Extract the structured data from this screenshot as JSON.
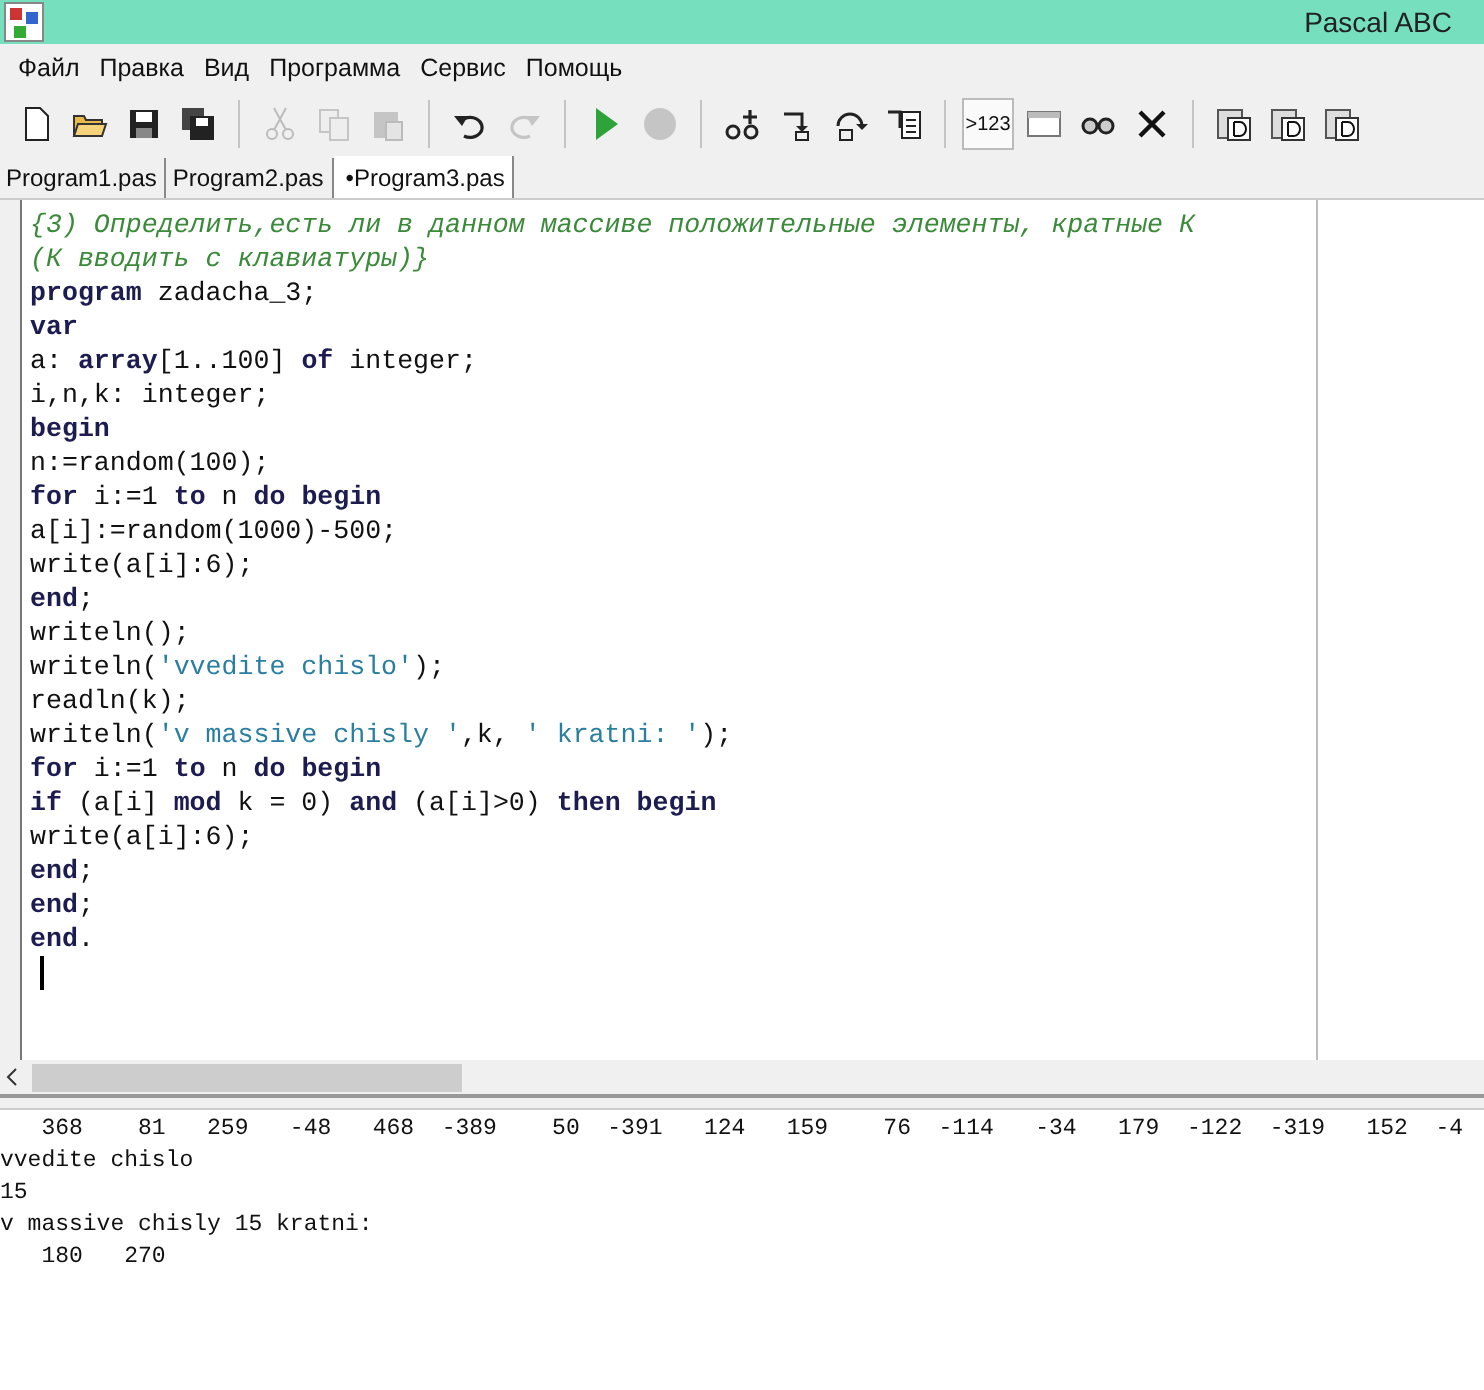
{
  "window": {
    "title": "Pascal ABC"
  },
  "menu": [
    "Файл",
    "Правка",
    "Вид",
    "Программа",
    "Сервис",
    "Помощь"
  ],
  "toolbar": {
    "output_toggle": {
      "label": ">123",
      "pressed": true
    }
  },
  "tabs": [
    {
      "label": "Program1.pas",
      "selected": false
    },
    {
      "label": "Program2.pas",
      "selected": false
    },
    {
      "label": "•Program3.pas",
      "selected": true
    }
  ],
  "editor": {
    "lines": [
      [
        {
          "kind": "comment",
          "text": "{3) Определить,есть ли в данном массиве положительные элементы, кратные К"
        }
      ],
      [
        {
          "kind": "comment",
          "text": "(К вводить с клавиатуры)}"
        }
      ],
      [
        {
          "kind": "keyword",
          "text": "program"
        },
        {
          "kind": "plain",
          "text": " zadacha_3;"
        }
      ],
      [
        {
          "kind": "keyword",
          "text": "var"
        }
      ],
      [
        {
          "kind": "plain",
          "text": "a: "
        },
        {
          "kind": "keyword",
          "text": "array"
        },
        {
          "kind": "plain",
          "text": "[1..100] "
        },
        {
          "kind": "keyword",
          "text": "of"
        },
        {
          "kind": "plain",
          "text": " integer;"
        }
      ],
      [
        {
          "kind": "plain",
          "text": "i,n,k: integer;"
        }
      ],
      [
        {
          "kind": "keyword",
          "text": "begin"
        }
      ],
      [
        {
          "kind": "plain",
          "text": "n:=random(100);"
        }
      ],
      [
        {
          "kind": "keyword",
          "text": "for"
        },
        {
          "kind": "plain",
          "text": " i:=1 "
        },
        {
          "kind": "keyword",
          "text": "to"
        },
        {
          "kind": "plain",
          "text": " n "
        },
        {
          "kind": "keyword",
          "text": "do begin"
        }
      ],
      [
        {
          "kind": "plain",
          "text": "a[i]:=random(1000)-500;"
        }
      ],
      [
        {
          "kind": "plain",
          "text": "write(a[i]:6);"
        }
      ],
      [
        {
          "kind": "keyword",
          "text": "end"
        },
        {
          "kind": "plain",
          "text": ";"
        }
      ],
      [
        {
          "kind": "plain",
          "text": "writeln();"
        }
      ],
      [
        {
          "kind": "plain",
          "text": "writeln("
        },
        {
          "kind": "string",
          "text": "'vvedite chislo'"
        },
        {
          "kind": "plain",
          "text": ");"
        }
      ],
      [
        {
          "kind": "plain",
          "text": "readln(k);"
        }
      ],
      [
        {
          "kind": "plain",
          "text": "writeln("
        },
        {
          "kind": "string",
          "text": "'v massive chisly '"
        },
        {
          "kind": "plain",
          "text": ",k, "
        },
        {
          "kind": "string",
          "text": "' kratni: '"
        },
        {
          "kind": "plain",
          "text": ");"
        }
      ],
      [
        {
          "kind": "keyword",
          "text": "for"
        },
        {
          "kind": "plain",
          "text": " i:=1 "
        },
        {
          "kind": "keyword",
          "text": "to"
        },
        {
          "kind": "plain",
          "text": " n "
        },
        {
          "kind": "keyword",
          "text": "do begin"
        }
      ],
      [
        {
          "kind": "keyword",
          "text": "if"
        },
        {
          "kind": "plain",
          "text": " (a[i] "
        },
        {
          "kind": "keyword",
          "text": "mod"
        },
        {
          "kind": "plain",
          "text": " k = 0) "
        },
        {
          "kind": "keyword",
          "text": "and"
        },
        {
          "kind": "plain",
          "text": " (a[i]>0) "
        },
        {
          "kind": "keyword",
          "text": "then begin"
        }
      ],
      [
        {
          "kind": "plain",
          "text": "write(a[i]:6);"
        }
      ],
      [
        {
          "kind": "keyword",
          "text": "end"
        },
        {
          "kind": "plain",
          "text": ";"
        }
      ],
      [
        {
          "kind": "keyword",
          "text": "end"
        },
        {
          "kind": "plain",
          "text": ";"
        }
      ],
      [
        {
          "kind": "keyword",
          "text": "end"
        },
        {
          "kind": "plain",
          "text": "."
        }
      ]
    ]
  },
  "output": {
    "lines": [
      "   368    81   259   -48   468  -389    50  -391   124   159    76  -114   -34   179  -122  -319   152  -4",
      "vvedite chislo",
      "15",
      "v massive chisly 15 kratni:",
      "   180   270"
    ]
  }
}
